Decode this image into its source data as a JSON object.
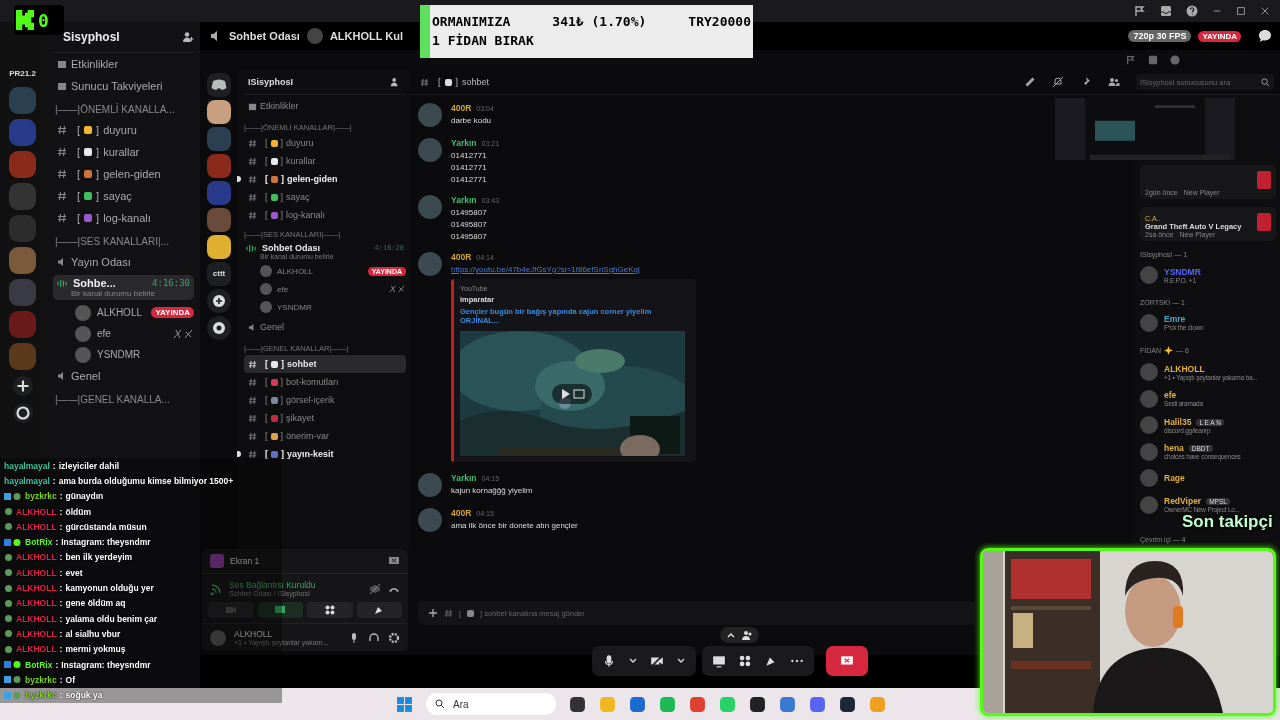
{
  "kick_badge": {
    "count": "0"
  },
  "donation_goal": {
    "line1": "ORMANIMIZA",
    "line2": "1 FİDAN BIRAK",
    "raised": "341₺ (1.70%)",
    "goal": "TRY20000",
    "level": 0.017
  },
  "outer": {
    "server_label": "PR21.2",
    "server_name": "Sisyphosl",
    "top_items": [
      "Etkinlikler",
      "Sunucu Takviyeleri"
    ],
    "cat1": "|——|ÖNEMLİ KANALLA...",
    "channels": [
      {
        "left": "[",
        "right": "]",
        "name": "duyuru",
        "color": "#f2b632"
      },
      {
        "left": "[",
        "right": "]",
        "name": "kurallar",
        "color": "#e8e8e8"
      },
      {
        "left": "[",
        "right": "]",
        "name": "gelen-giden",
        "color": "#d0743c"
      },
      {
        "left": "[",
        "right": "]",
        "name": "sayaç",
        "color": "#3fbf5f"
      },
      {
        "left": "[",
        "right": "]",
        "name": "log-kanalı",
        "color": "#9b59d0"
      }
    ],
    "cat2": "|——|SES KANALLARI|...",
    "voice1": "Yayın Odası",
    "voice_active": {
      "name": "Sohbe...",
      "time": "4:16:30",
      "status": "Bir kanal durumu belirle"
    },
    "voice_members": [
      {
        "name": "ALKHOLL",
        "live": true,
        "live_label": "YAYINDA",
        "muted": false
      },
      {
        "name": "efe",
        "live": false,
        "muted": true
      },
      {
        "name": "YSNDMR",
        "live": false,
        "muted": false
      }
    ],
    "voice2": "Genel",
    "cat3": "|——|GENEL KANALLA...",
    "header": {
      "channel": "Sohbet Odası",
      "user": "ALKHOLL Kul"
    },
    "quality": "720p 30 FPS",
    "live_label": "YAYINDA"
  },
  "nested": {
    "rail_label": "cttt",
    "server_name": "ISisyphosI",
    "events": "Etkinlikler",
    "cat1": "|——|ÖNEMLİ KANALLAR|——|",
    "channels1": [
      {
        "left": "[",
        "right": "]",
        "name": "duyuru",
        "color": "#f2b632",
        "unread": false
      },
      {
        "left": "[",
        "right": "]",
        "name": "kurallar",
        "color": "#e8e8e8",
        "unread": false
      },
      {
        "left": "[",
        "right": "]",
        "name": "gelen-giden",
        "color": "#d0743c",
        "unread": true
      },
      {
        "left": "[",
        "right": "]",
        "name": "sayaç",
        "color": "#3fbf5f",
        "unread": false
      },
      {
        "left": "[",
        "right": "]",
        "name": "log-kanalı",
        "color": "#9b59d0",
        "unread": false
      }
    ],
    "cat2": "|——|SES KANALLARI|——|",
    "voice_active": {
      "name": "Sohbet Odası",
      "time": "4:16:28",
      "status": "Bir kanal durumu belirle"
    },
    "voice_members": [
      {
        "name": "ALKHOLL",
        "live": true,
        "live_label": "YAYINDA",
        "muted": false
      },
      {
        "name": "efe",
        "live": false,
        "muted": true
      },
      {
        "name": "YSNDMR",
        "live": false,
        "muted": false
      }
    ],
    "voice2": "Genel",
    "cat3": "|——|GENEL KANALLAR|——|",
    "channels3": [
      {
        "left": "[",
        "right": "]",
        "name": "sohbet",
        "color": "#e8e8e8",
        "selected": true,
        "unread": false
      },
      {
        "left": "[",
        "right": "]",
        "name": "bot-komutları",
        "color": "#d03a5a",
        "selected": false,
        "unread": false
      },
      {
        "left": "[",
        "right": "]",
        "name": "görsel-içerik",
        "color": "#7a8aa0",
        "selected": false,
        "unread": false
      },
      {
        "left": "[",
        "right": "]",
        "name": "şikayet",
        "color": "#c0303a",
        "selected": false,
        "unread": false
      },
      {
        "left": "[",
        "right": "]",
        "name": "önerim-var",
        "color": "#e0a050",
        "selected": false,
        "unread": false
      },
      {
        "left": "[",
        "right": "]",
        "name": "yayın-kesit",
        "color": "#6070c0",
        "selected": false,
        "unread": true
      }
    ],
    "voice_panel": {
      "screen": "Ekran 1",
      "connection": "Ses Bağlantısı Kuruldu",
      "location": "Sohbet Odası / ISisyphosI",
      "user": "ALKHOLL",
      "user_status": "+1 • Yapıştı şeytanlar yakam..."
    },
    "chat_header": {
      "left": "[",
      "right": "]",
      "channel": "sohbet",
      "search_placeholder": "ISisyphosI sunucusunu ara"
    },
    "messages": [
      {
        "author": "400R",
        "color": "#d4a530",
        "time": "03:04",
        "lines": [
          "darbe kodu"
        ]
      },
      {
        "author": "Yarkın",
        "color": "#3fbf6f",
        "time": "03:21",
        "lines": [
          "01412771",
          "01412771",
          "01412771"
        ]
      },
      {
        "author": "Yarkın",
        "color": "#3fbf6f",
        "time": "03:43",
        "lines": [
          "01495807",
          "01495807",
          "01495807"
        ]
      },
      {
        "author": "400R",
        "color": "#d4a530",
        "time": "04:14",
        "link": "https://youtu.be/47b4eJfGsYg?si=1f86efSnSghGeKgj",
        "embed": {
          "provider": "YouTube",
          "author": "imparatar",
          "title": "Gençler bugün bir bağış yapında cajun corner yiyelim ORJİNAL..."
        }
      },
      {
        "author": "Yarkın",
        "color": "#3fbf6f",
        "time": "04:15",
        "lines": [
          "kajun kornağğğ yiyelim"
        ]
      },
      {
        "author": "400R",
        "color": "#d4a530",
        "time": "04:15",
        "lines": [
          "ama ilk önce bir donete atın gençler"
        ]
      }
    ],
    "input": {
      "left": "[",
      "right": "]",
      "placeholder": "sohbet kanalına mesaj gönder"
    },
    "activity": [
      {
        "time": "2gün önce",
        "tag": "New Player"
      },
      {
        "title": "C.A..",
        "game": "Grand Theft Auto V Legacy",
        "time": "2sa önce",
        "tag": "New Player"
      }
    ],
    "groups": [
      {
        "name": "ISisyphosI — 1",
        "members": [
          {
            "name": "YSNDMR",
            "color": "#5865f2",
            "status": "R.E.P.O. +1"
          }
        ]
      },
      {
        "name": "ZORTSKİ — 1",
        "members": [
          {
            "name": "Emre",
            "color": "#4aa8c0",
            "status": "F*ck the clown"
          }
        ]
      },
      {
        "name": "FİDAN",
        "kind": "sparkle",
        "count": "— 6",
        "members": [
          {
            "name": "ALKHOLL",
            "color": "#e0b040",
            "status": "+1 • Yapıştı şeytanlar yakama ba..."
          },
          {
            "name": "efe",
            "color": "#e0b040",
            "status": "Sesli aramada"
          },
          {
            "name": "Halil35",
            "color": "#e0b040",
            "tag": "L E A N",
            "status": "discord.gg/leanrp"
          },
          {
            "name": "hena",
            "color": "#e0b040",
            "tag": "DBDT",
            "status": "choices have consequences"
          },
          {
            "name": "Rage",
            "color": "#e0b040"
          },
          {
            "name": "RedViper",
            "color": "#e0b040",
            "tag": "MPSL",
            "status": "OwnerMC New Project Lo..."
          }
        ]
      },
      {
        "name": "Çevrim içi — 4"
      }
    ]
  },
  "stream_chat": [
    {
      "user": "hayalmayal",
      "color": "#3fc1a0",
      "separator": ":",
      "text": "izleyiciler dahil"
    },
    {
      "user": "hayalmayal",
      "color": "#3fc1a0",
      "separator": ":",
      "text": "ama burda olduğumu kimse bilmiyor 1500+"
    },
    {
      "kind": "vip",
      "user": "byzkrkc",
      "color": "#7ed321",
      "separator": ":",
      "text": "günaydın"
    },
    {
      "kind": "sub",
      "user": "ALKHOLL",
      "color": "#e0204a",
      "separator": ":",
      "text": "öldüm"
    },
    {
      "kind": "sub",
      "user": "ALKHOLL",
      "color": "#e0204a",
      "separator": ":",
      "text": "gürcüstanda müsun"
    },
    {
      "kind": "bot",
      "user": "BotRix",
      "color": "#53fc18",
      "separator": ":",
      "text": "Instagram: theysndmr"
    },
    {
      "kind": "sub",
      "user": "ALKHOLL",
      "color": "#e0204a",
      "separator": ":",
      "text": "ben ilk yerdeyim"
    },
    {
      "kind": "sub",
      "user": "ALKHOLL",
      "color": "#e0204a",
      "separator": ":",
      "text": "evet"
    },
    {
      "kind": "sub",
      "user": "ALKHOLL",
      "color": "#e0204a",
      "separator": ":",
      "text": "kamyonun olduğu yer"
    },
    {
      "kind": "sub",
      "user": "ALKHOLL",
      "color": "#e0204a",
      "separator": ":",
      "text": "gene öldüm aq"
    },
    {
      "kind": "sub",
      "user": "ALKHOLL",
      "color": "#e0204a",
      "separator": ":",
      "text": "yalama oldu benim çar"
    },
    {
      "kind": "sub",
      "user": "ALKHOLL",
      "color": "#e0204a",
      "separator": ":",
      "text": "al sialhu vbur"
    },
    {
      "kind": "sub",
      "user": "ALKHOLL",
      "color": "#e0204a",
      "separator": ":",
      "text": "mermi yokmuş"
    },
    {
      "kind": "bot",
      "user": "BotRix",
      "color": "#53fc18",
      "separator": ":",
      "text": "Instagram: theysndmr"
    },
    {
      "kind": "vip",
      "user": "byzkrkc",
      "color": "#7ed321",
      "separator": ":",
      "text": "Of"
    },
    {
      "kind": "vip",
      "user": "byzkrkc",
      "color": "#7ed321",
      "separator": ":",
      "text": "soğuk ya"
    }
  ],
  "follower_alert": "Son takipçi",
  "taskbar": {
    "search_placeholder": "Ara"
  }
}
